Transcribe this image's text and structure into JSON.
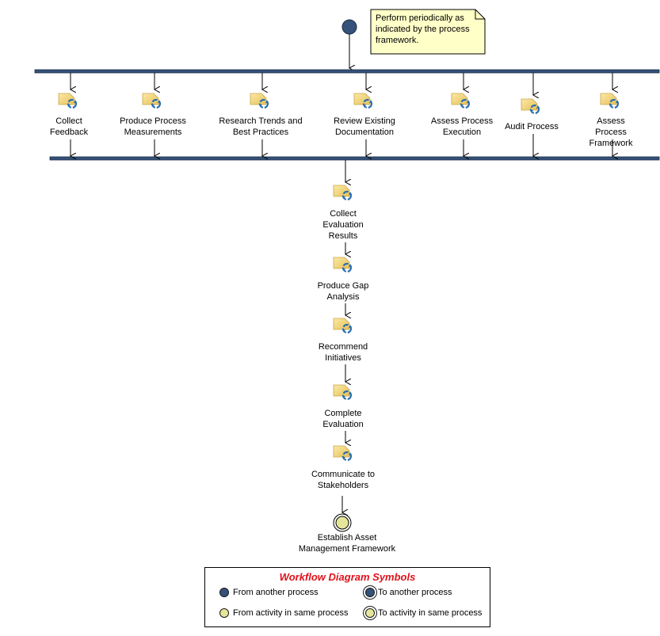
{
  "note": {
    "text": "Perform periodically as\nindicated by the process\nframework."
  },
  "parallel_activities": [
    {
      "label": "Collect\nFeedback",
      "icon": "activity-task-icon"
    },
    {
      "label": "Produce Process\nMeasurements",
      "icon": "activity-task-icon"
    },
    {
      "label": "Research Trends and\nBest Practices",
      "icon": "activity-task-icon"
    },
    {
      "label": "Review Existing\nDocumentation",
      "icon": "activity-task-icon"
    },
    {
      "label": "Assess Process\nExecution",
      "icon": "activity-task-icon"
    },
    {
      "label": "Audit Process",
      "icon": "activity-task-icon"
    },
    {
      "label": "Assess Process\nFramework",
      "icon": "activity-task-icon"
    }
  ],
  "sequential_activities": [
    {
      "label": "Collect\nEvaluation\nResults",
      "icon": "activity-task-icon"
    },
    {
      "label": "Produce Gap\nAnalysis",
      "icon": "activity-task-icon"
    },
    {
      "label": "Recommend\nInitiatives",
      "icon": "activity-task-icon"
    },
    {
      "label": "Complete\nEvaluation",
      "icon": "activity-task-icon"
    },
    {
      "label": "Communicate to\nStakeholders",
      "icon": "activity-task-icon"
    }
  ],
  "end_node": {
    "label": "Establish Asset\nManagement Framework"
  },
  "legend": {
    "title": "Workflow Diagram Symbols",
    "items": [
      {
        "label": "From another process",
        "symbol": "from-another-process"
      },
      {
        "label": "To another process",
        "symbol": "to-another-process"
      },
      {
        "label": "From activity in same process",
        "symbol": "from-activity-same-process"
      },
      {
        "label": "To activity in same process",
        "symbol": "to-activity-same-process"
      }
    ]
  },
  "colors": {
    "bar": "#34527a",
    "node_blue": "#34527a",
    "node_yellow": "#e6e69a",
    "note_fill": "#ffffc8",
    "legend_title": "#e0101a"
  }
}
